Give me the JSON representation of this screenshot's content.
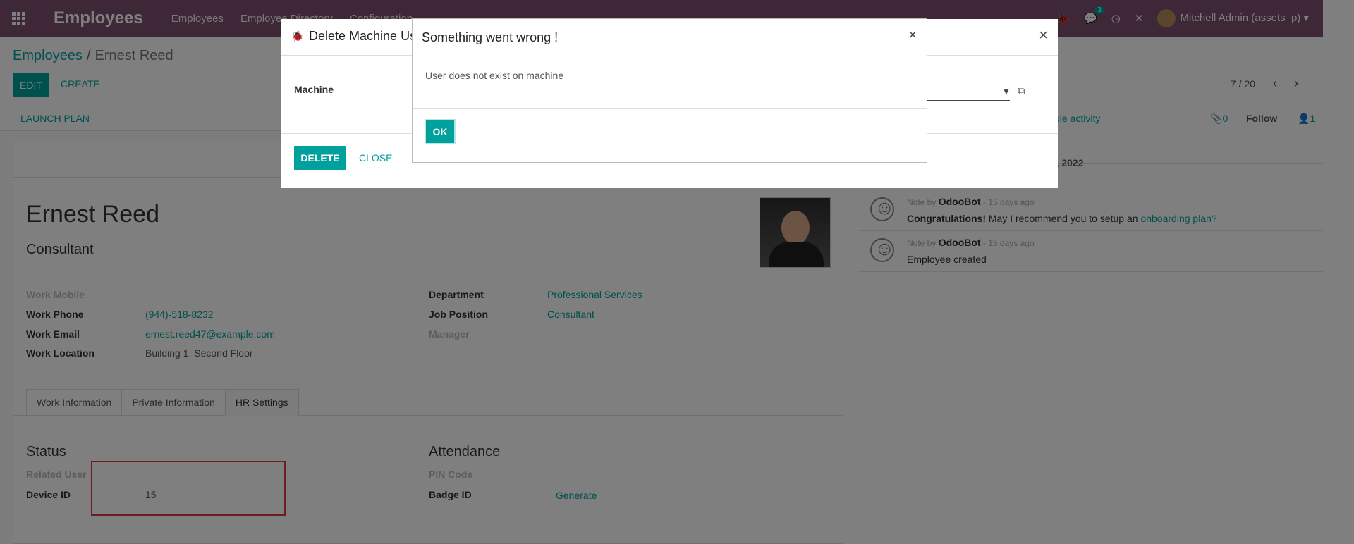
{
  "navbar": {
    "brand": "Employees",
    "menu": [
      "Employees",
      "Employee Directory",
      "Configuration"
    ],
    "messages_count": "3",
    "user": "Mitchell Admin (assets_p)",
    "icons": [
      "bug-icon",
      "chat-icon",
      "clock-icon",
      "tools-icon"
    ]
  },
  "breadcrumb": {
    "parent": "Employees",
    "current": "Ernest Reed"
  },
  "control": {
    "edit": "EDIT",
    "create": "CREATE",
    "pager": "7 / 20"
  },
  "statusbar": {
    "launch_plan": "LAUNCH PLAN"
  },
  "employee": {
    "name": "Ernest Reed",
    "job_title": "Consultant",
    "work_mobile_label": "Work Mobile",
    "work_phone_label": "Work Phone",
    "work_phone": "(944)-518-8232",
    "work_email_label": "Work Email",
    "work_email": "ernest.reed47@example.com",
    "work_location_label": "Work Location",
    "work_location": "Building 1, Second Floor",
    "department_label": "Department",
    "department": "Professional Services",
    "job_position_label": "Job Position",
    "job_position": "Consultant",
    "manager_label": "Manager"
  },
  "tabs": [
    "Work Information",
    "Private Information",
    "HR Settings"
  ],
  "hr_settings": {
    "status_title": "Status",
    "related_user_label": "Related User",
    "device_id_label": "Device ID",
    "device_id": "15",
    "attendance_title": "Attendance",
    "pin_code_label": "PIN Code",
    "badge_id_label": "Badge ID",
    "generate": "Generate"
  },
  "chatter": {
    "schedule_activity": "ule activity",
    "attachments": "0",
    "follow": "Follow",
    "followers": "1",
    "date": "ugust 18, 2022",
    "messages": [
      {
        "prefix": "Note by",
        "author": "OdooBot",
        "time": "- 15 days ago",
        "bold": "Congratulations!",
        "text": " May I recommend you to setup an ",
        "link": "onboarding plan?"
      },
      {
        "prefix": "Note by",
        "author": "OdooBot",
        "time": "- 15 days ago",
        "bold": "",
        "text": "Employee created",
        "link": ""
      }
    ]
  },
  "dialog_delete": {
    "title": "Delete Machine Use",
    "machine_label": "Machine",
    "delete": "DELETE",
    "close": "CLOSE"
  },
  "dialog_error": {
    "title": "Something went wrong !",
    "message": "User does not exist on machine",
    "ok": "OK"
  },
  "colors": {
    "brand": "#7c4f6e",
    "accent": "#00a09d",
    "highlight": "#e03a3a"
  }
}
